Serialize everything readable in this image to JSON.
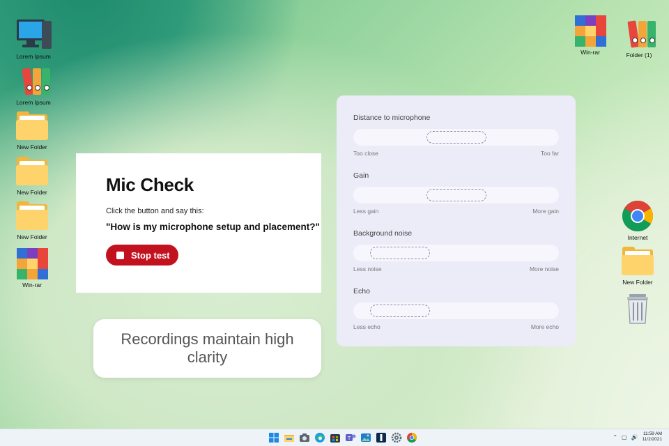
{
  "desktop_left": [
    {
      "label": "Lorem Ipsum",
      "icon": "computer-icon"
    },
    {
      "label": "Lorem Ipsum",
      "icon": "binders-icon"
    },
    {
      "label": "New Folder",
      "icon": "folder-icon"
    },
    {
      "label": "New Folder",
      "icon": "folder-icon"
    },
    {
      "label": "New Folder",
      "icon": "folder-icon"
    },
    {
      "label": "Win-rar",
      "icon": "winrar-icon"
    }
  ],
  "desktop_top_right": [
    {
      "label": "Win-rar",
      "icon": "winrar-icon"
    },
    {
      "label": "Folder (1)",
      "icon": "binders-icon"
    }
  ],
  "desktop_right": [
    {
      "label": "Internet",
      "icon": "chrome-icon"
    },
    {
      "label": "New Folder",
      "icon": "folder-icon"
    },
    {
      "label": "",
      "icon": "recycle-bin-icon"
    }
  ],
  "mic_check": {
    "title": "Mic Check",
    "instruction": "Click the button and say this:",
    "quote": "\"How is my microphone setup and placement?\"",
    "stop_label": "Stop test",
    "accent": "#c3121f"
  },
  "callout": {
    "text": "Recordings maintain high clarity"
  },
  "metrics": [
    {
      "name": "Distance to microphone",
      "low": "Too close",
      "high": "Too far",
      "level": 0.5
    },
    {
      "name": "Gain",
      "low": "Less gain",
      "high": "More gain",
      "level": 0.5
    },
    {
      "name": "Background noise",
      "low": "Less noise",
      "high": "More noise",
      "level": 0.1
    },
    {
      "name": "Echo",
      "low": "Less echo",
      "high": "More echo",
      "level": 0.1
    }
  ],
  "taskbar": {
    "apps": [
      "windows-start-icon",
      "file-explorer-icon",
      "camera-icon",
      "edge-icon",
      "store-icon",
      "teams-icon",
      "photos-icon",
      "app-icon",
      "settings-icon",
      "chrome-icon"
    ],
    "time": "11:59 AM",
    "date": "11/2/2021"
  }
}
